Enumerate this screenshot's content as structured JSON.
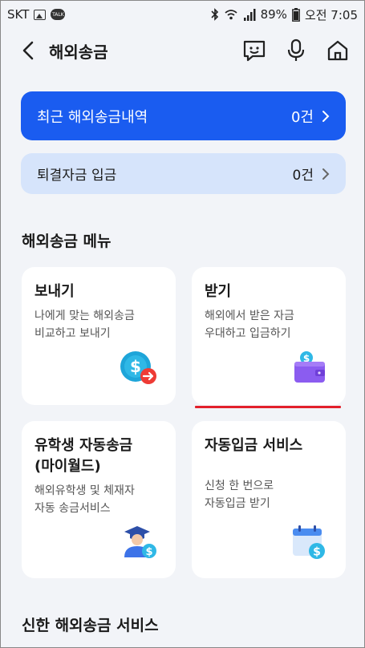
{
  "status": {
    "carrier": "SKT",
    "talk": "TALK",
    "battery": "89%",
    "time": "오전 7:05"
  },
  "header": {
    "title": "해외송금"
  },
  "recent": {
    "label": "최근 해외송금내역",
    "count": "0건"
  },
  "returned": {
    "label": "퇴결자금 입금",
    "count": "0건"
  },
  "menu_title": "해외송금 메뉴",
  "cards": [
    {
      "title": "보내기",
      "desc1": "나에게 맞는 해외송금",
      "desc2": "비교하고 보내기"
    },
    {
      "title": "받기",
      "desc1": "해외에서 받은 자금",
      "desc2": "우대하고 입금하기"
    },
    {
      "title": "유학생 자동송금",
      "title2": "(마이월드)",
      "desc1": "해외유학생 및 체재자",
      "desc2": "자동 송금서비스"
    },
    {
      "title": "자동입금 서비스",
      "desc1": "신청 한 번으로",
      "desc2": "자동입금 받기"
    }
  ],
  "service_title": "신한 해외송금 서비스",
  "colors": {
    "primary": "#1a5cf0",
    "light": "#d6e4fb",
    "accent": "#e3202b",
    "bg": "#f2f4f8"
  }
}
